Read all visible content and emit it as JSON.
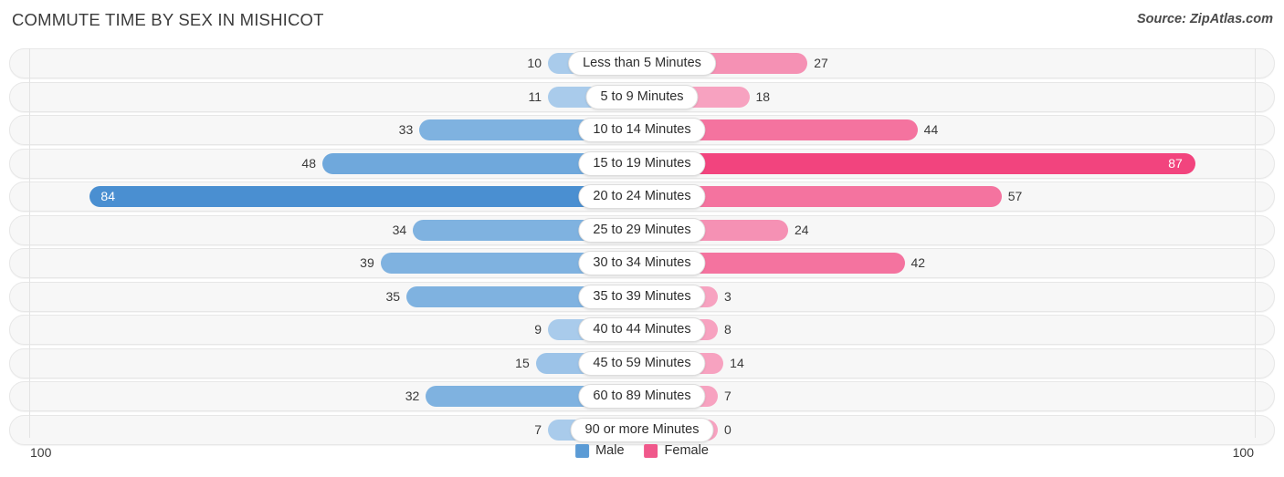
{
  "header": {
    "title": "COMMUTE TIME BY SEX IN MISHICOT",
    "source": "Source: ZipAtlas.com"
  },
  "footer": {
    "axis_left": "100",
    "axis_right": "100",
    "legend": [
      {
        "label": "Male",
        "color": "#5b9bd5"
      },
      {
        "label": "Female",
        "color": "#f0588b"
      }
    ]
  },
  "chart_data": {
    "type": "bar",
    "subtype": "diverging-horizontal-bar",
    "title": "COMMUTE TIME BY SEX IN MISHICOT",
    "xlabel": "",
    "ylabel": "",
    "xlim": [
      100,
      100
    ],
    "grid": true,
    "legend_position": "bottom-center",
    "categories": [
      "Less than 5 Minutes",
      "5 to 9 Minutes",
      "10 to 14 Minutes",
      "15 to 19 Minutes",
      "20 to 24 Minutes",
      "25 to 29 Minutes",
      "30 to 34 Minutes",
      "35 to 39 Minutes",
      "40 to 44 Minutes",
      "45 to 59 Minutes",
      "60 to 89 Minutes",
      "90 or more Minutes"
    ],
    "series": [
      {
        "name": "Male",
        "color": "#5b9bd5",
        "direction": "left",
        "values": [
          10,
          11,
          33,
          48,
          84,
          34,
          39,
          35,
          9,
          15,
          32,
          7
        ]
      },
      {
        "name": "Female",
        "color": "#f0588b",
        "direction": "right",
        "values": [
          27,
          18,
          44,
          87,
          57,
          24,
          42,
          3,
          8,
          14,
          7,
          0
        ]
      }
    ]
  }
}
